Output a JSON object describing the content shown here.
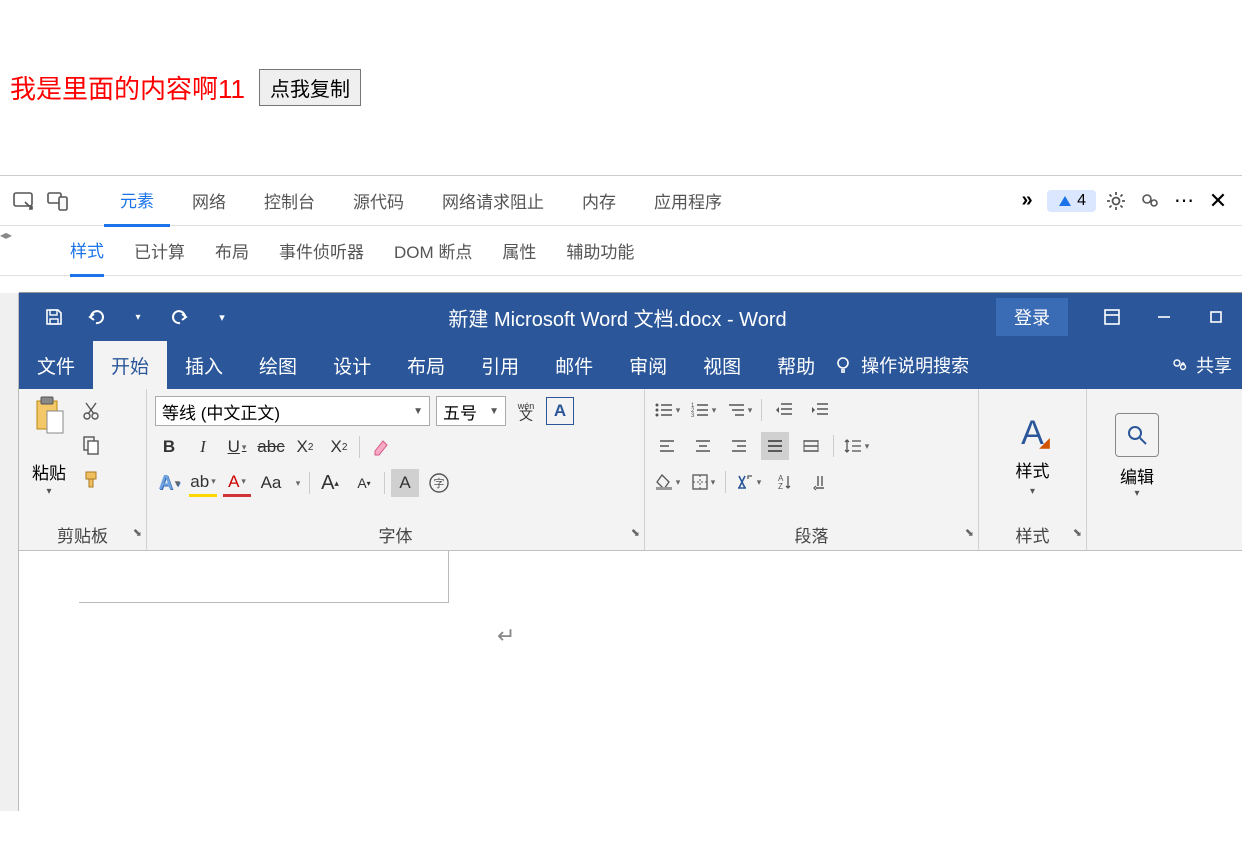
{
  "page": {
    "content_text": "我是里面的内容啊11",
    "copy_button": "点我复制"
  },
  "devtools": {
    "tabs": [
      "元素",
      "网络",
      "控制台",
      "源代码",
      "网络请求阻止",
      "内存",
      "应用程序"
    ],
    "active_tab_index": 0,
    "issue_count": "4",
    "subtabs": [
      "样式",
      "已计算",
      "布局",
      "事件侦听器",
      "DOM 断点",
      "属性",
      "辅助功能"
    ],
    "active_sub_index": 0
  },
  "word": {
    "title": "新建 Microsoft Word 文档.docx  -  Word",
    "login": "登录",
    "menu": [
      "文件",
      "开始",
      "插入",
      "绘图",
      "设计",
      "布局",
      "引用",
      "邮件",
      "审阅",
      "视图",
      "帮助"
    ],
    "active_menu_index": 1,
    "tell_me": "操作说明搜索",
    "share": "共享",
    "ribbon": {
      "clipboard": {
        "label": "剪贴板",
        "paste": "粘贴"
      },
      "font": {
        "label": "字体",
        "font_name": "等线 (中文正文)",
        "font_size": "五号",
        "phonetic": "wén",
        "phonetic2": "文",
        "char_border": "A",
        "aa": "Aa"
      },
      "paragraph": {
        "label": "段落"
      },
      "styles": {
        "label": "样式",
        "text": "样式"
      },
      "edit": {
        "label": "编辑",
        "text": "编辑"
      }
    },
    "para_mark": "↵"
  }
}
